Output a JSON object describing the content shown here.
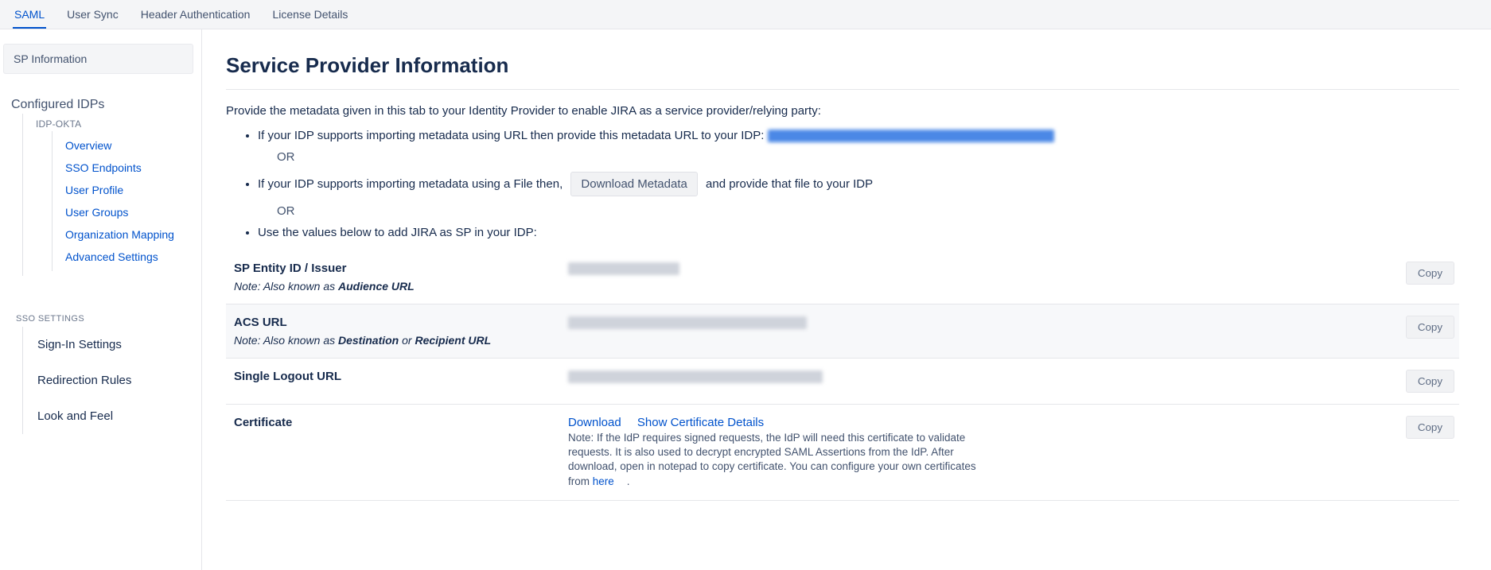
{
  "top_tabs": {
    "saml": "SAML",
    "user_sync": "User Sync",
    "header_auth": "Header Authentication",
    "license": "License Details"
  },
  "sidebar": {
    "sp_info": "SP Information",
    "configured_idps_label": "Configured IDPs",
    "idp_name": "IDP-OKTA",
    "links": {
      "overview": "Overview",
      "sso_endpoints": "SSO Endpoints",
      "user_profile": "User Profile",
      "user_groups": "User Groups",
      "org_mapping": "Organization Mapping",
      "advanced": "Advanced Settings"
    },
    "sso_settings_label": "SSO SETTINGS",
    "sso_items": {
      "signin": "Sign-In Settings",
      "redirection": "Redirection Rules",
      "look_feel": "Look and Feel"
    }
  },
  "main": {
    "title": "Service Provider Information",
    "intro": "Provide the metadata given in this tab to your Identity Provider to enable JIRA as a service provider/relying party:",
    "bullet1": "If your IDP supports importing metadata using URL then provide this metadata URL to your IDP: ",
    "or": "OR",
    "bullet2_pre": "If your IDP supports importing metadata using a File then, ",
    "download_metadata_label": "Download Metadata",
    "bullet2_post": " and provide that file to your IDP",
    "bullet3": "Use the values below to add JIRA as SP in your IDP:",
    "rows": {
      "sp_entity": {
        "label": "SP Entity ID / Issuer",
        "note_prefix": "Note: Also known as ",
        "note_bold": "Audience URL"
      },
      "acs": {
        "label": "ACS URL",
        "note_prefix": "Note: Also known as ",
        "note_bold1": "Destination",
        "note_mid": " or ",
        "note_bold2": "Recipient URL"
      },
      "slo": {
        "label": "Single Logout URL"
      },
      "cert": {
        "label": "Certificate",
        "download": "Download",
        "show": "Show Certificate Details",
        "note": "Note: If the IdP requires signed requests, the IdP will need this certificate to validate requests. It is also used to decrypt encrypted SAML Assertions from the IdP. After download, open in notepad to copy certificate. You can configure your own certificates from ",
        "here": "here"
      }
    },
    "copy_label": "Copy"
  }
}
